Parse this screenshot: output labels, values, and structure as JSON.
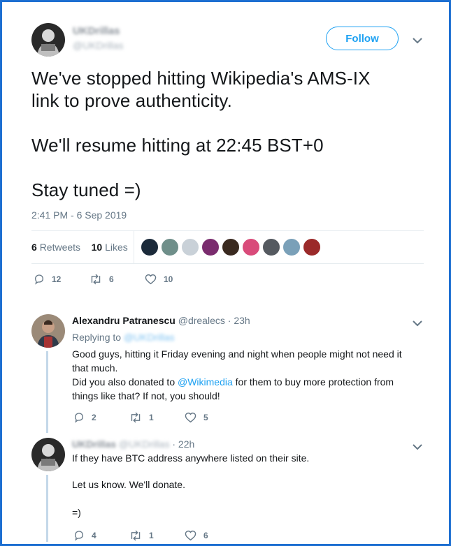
{
  "main_tweet": {
    "display_name": "UKDrillas",
    "handle": "@UKDrillas",
    "follow_label": "Follow",
    "text_lines": [
      "We've stopped hitting Wikipedia's AMS-IX",
      "link to prove authenticity.",
      "We'll resume hitting at 22:45 BST+0",
      "Stay tuned =)"
    ],
    "timestamp": "2:41 PM - 6 Sep 2019",
    "retweets_count": "6",
    "retweets_label": "Retweets",
    "likes_count": "10",
    "likes_label": "Likes",
    "actions": {
      "replies": "12",
      "retweets": "6",
      "likes": "10"
    }
  },
  "replies": [
    {
      "display_name": "Alexandru Patranescu",
      "handle": "@drealecs",
      "time": "· 23h",
      "replying_label": "Replying to",
      "replying_to": "@UKDrillas",
      "lines": [
        "Good guys, hitting it Friday evening and night when people might not need it",
        "that much.",
        "Did you also donated to",
        "@Wikimedia",
        "for them to buy more protection from",
        "things like that? If not, you should!"
      ],
      "actions": {
        "replies": "2",
        "retweets": "1",
        "likes": "5"
      }
    },
    {
      "display_name": "UKDrillas",
      "handle": "@UKDrillas",
      "time": "· 22h",
      "lines": [
        "If they have BTC address anywhere listed on their site.",
        "Let us know. We'll donate.",
        "=)"
      ],
      "actions": {
        "replies": "4",
        "retweets": "1",
        "likes": "6"
      }
    }
  ],
  "liker_colors": [
    "#1b2a3a",
    "#6f8f8a",
    "#c9d1d8",
    "#7a2c6e",
    "#3a2a20",
    "#d94b7a",
    "#555a60",
    "#7aa0b8",
    "#9b2a2a"
  ],
  "colors": {
    "accent": "#1da1f2",
    "text": "#14171a",
    "muted": "#657786",
    "border": "#1d6fd1"
  }
}
